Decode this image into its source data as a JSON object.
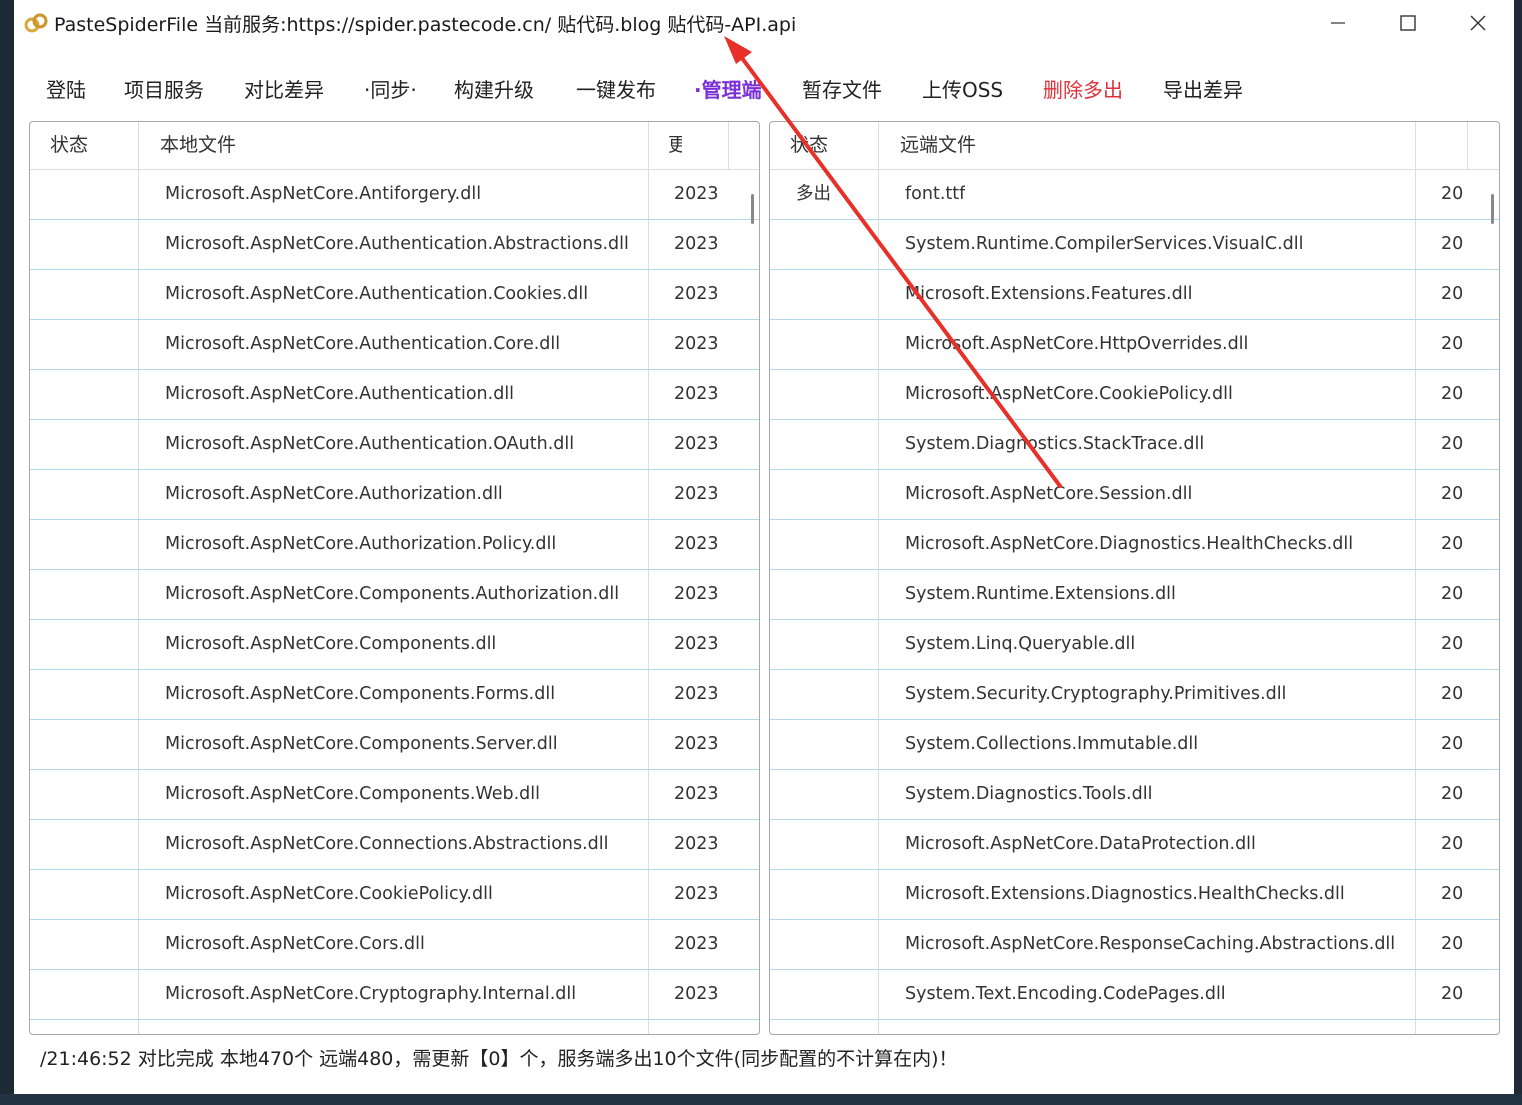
{
  "window": {
    "title": "PasteSpiderFile 当前服务:https://spider.pastecode.cn/ 贴代码.blog 贴代码-API.api"
  },
  "menu": [
    {
      "label": "登陆",
      "color": "#222222"
    },
    {
      "label": "项目服务",
      "color": "#222222"
    },
    {
      "label": "对比差异",
      "color": "#222222"
    },
    {
      "label": "·同步·",
      "color": "#222222"
    },
    {
      "label": "构建升级",
      "color": "#222222"
    },
    {
      "label": "一键发布",
      "color": "#222222"
    },
    {
      "label": "·管理端",
      "color": "#7b2fd6"
    },
    {
      "label": "暂存文件",
      "color": "#222222"
    },
    {
      "label": "上传OSS",
      "color": "#222222"
    },
    {
      "label": "删除多出",
      "color": "#e0303a"
    },
    {
      "label": "导出差异",
      "color": "#222222"
    }
  ],
  "left_table": {
    "headers": [
      "状态",
      "本地文件",
      "更"
    ],
    "rows": [
      {
        "status": "",
        "file": "Microsoft.AspNetCore.Antiforgery.dll",
        "date": "2023"
      },
      {
        "status": "",
        "file": "Microsoft.AspNetCore.Authentication.Abstractions.dll",
        "date": "2023"
      },
      {
        "status": "",
        "file": "Microsoft.AspNetCore.Authentication.Cookies.dll",
        "date": "2023"
      },
      {
        "status": "",
        "file": "Microsoft.AspNetCore.Authentication.Core.dll",
        "date": "2023"
      },
      {
        "status": "",
        "file": "Microsoft.AspNetCore.Authentication.dll",
        "date": "2023"
      },
      {
        "status": "",
        "file": "Microsoft.AspNetCore.Authentication.OAuth.dll",
        "date": "2023"
      },
      {
        "status": "",
        "file": "Microsoft.AspNetCore.Authorization.dll",
        "date": "2023"
      },
      {
        "status": "",
        "file": "Microsoft.AspNetCore.Authorization.Policy.dll",
        "date": "2023"
      },
      {
        "status": "",
        "file": "Microsoft.AspNetCore.Components.Authorization.dll",
        "date": "2023"
      },
      {
        "status": "",
        "file": "Microsoft.AspNetCore.Components.dll",
        "date": "2023"
      },
      {
        "status": "",
        "file": "Microsoft.AspNetCore.Components.Forms.dll",
        "date": "2023"
      },
      {
        "status": "",
        "file": "Microsoft.AspNetCore.Components.Server.dll",
        "date": "2023"
      },
      {
        "status": "",
        "file": "Microsoft.AspNetCore.Components.Web.dll",
        "date": "2023"
      },
      {
        "status": "",
        "file": "Microsoft.AspNetCore.Connections.Abstractions.dll",
        "date": "2023"
      },
      {
        "status": "",
        "file": "Microsoft.AspNetCore.CookiePolicy.dll",
        "date": "2023"
      },
      {
        "status": "",
        "file": "Microsoft.AspNetCore.Cors.dll",
        "date": "2023"
      },
      {
        "status": "",
        "file": "Microsoft.AspNetCore.Cryptography.Internal.dll",
        "date": "2023"
      }
    ]
  },
  "right_table": {
    "headers": [
      "状态",
      "远端文件",
      ""
    ],
    "rows": [
      {
        "status": "多出",
        "file": "font.ttf",
        "date": "20"
      },
      {
        "status": "",
        "file": "System.Runtime.CompilerServices.VisualC.dll",
        "date": "20"
      },
      {
        "status": "",
        "file": "Microsoft.Extensions.Features.dll",
        "date": "20"
      },
      {
        "status": "",
        "file": "Microsoft.AspNetCore.HttpOverrides.dll",
        "date": "20"
      },
      {
        "status": "",
        "file": "Microsoft.AspNetCore.CookiePolicy.dll",
        "date": "20"
      },
      {
        "status": "",
        "file": "System.Diagnostics.StackTrace.dll",
        "date": "20"
      },
      {
        "status": "",
        "file": "Microsoft.AspNetCore.Session.dll",
        "date": "20"
      },
      {
        "status": "",
        "file": "Microsoft.AspNetCore.Diagnostics.HealthChecks.dll",
        "date": "20"
      },
      {
        "status": "",
        "file": "System.Runtime.Extensions.dll",
        "date": "20"
      },
      {
        "status": "",
        "file": "System.Linq.Queryable.dll",
        "date": "20"
      },
      {
        "status": "",
        "file": "System.Security.Cryptography.Primitives.dll",
        "date": "20"
      },
      {
        "status": "",
        "file": "System.Collections.Immutable.dll",
        "date": "20"
      },
      {
        "status": "",
        "file": "System.Diagnostics.Tools.dll",
        "date": "20"
      },
      {
        "status": "",
        "file": "Microsoft.AspNetCore.DataProtection.dll",
        "date": "20"
      },
      {
        "status": "",
        "file": "Microsoft.Extensions.Diagnostics.HealthChecks.dll",
        "date": "20"
      },
      {
        "status": "",
        "file": "Microsoft.AspNetCore.ResponseCaching.Abstractions.dll",
        "date": "20"
      },
      {
        "status": "",
        "file": "System.Text.Encoding.CodePages.dll",
        "date": "20"
      }
    ]
  },
  "status_bar": {
    "text": "/21:46:52 对比完成 本地470个 远端480，需更新【0】个，服务端多出10个文件(同步配置的不计算在内)！"
  },
  "colors": {
    "arrow": "#e8302a",
    "grid_line": "#b4d7ea"
  }
}
